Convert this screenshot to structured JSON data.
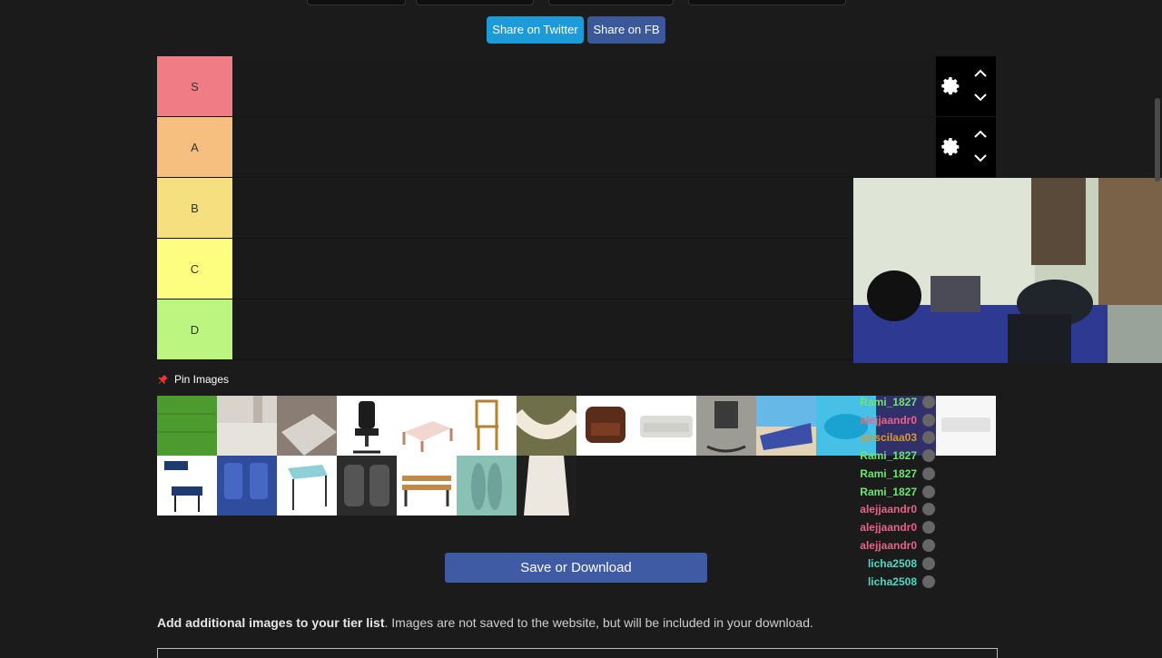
{
  "share": {
    "twitter": "Share on Twitter",
    "fb": "Share on FB"
  },
  "tiers": [
    {
      "label": "S",
      "color": "#f07d85"
    },
    {
      "label": "A",
      "color": "#f6bf7f"
    },
    {
      "label": "B",
      "color": "#f6df7f"
    },
    {
      "label": "C",
      "color": "#fdfd7f"
    },
    {
      "label": "D",
      "color": "#bcf57f"
    }
  ],
  "pin_images": "Pin Images",
  "images": [
    "grass",
    "floor",
    "rug",
    "gaming-chair",
    "bed",
    "wooden-chair",
    "hammock",
    "armchair",
    "sofa",
    "rocking-chair",
    "beach-towel",
    "pool-float",
    "mattress",
    "school-desk-chair",
    "bus-seats",
    "student-desk",
    "car-seats",
    "bench",
    "feet",
    "blouse"
  ],
  "chat": [
    {
      "name": "Rami_1827",
      "color": "#6ee66e"
    },
    {
      "name": "alejjaandr0",
      "color": "#e8638a"
    },
    {
      "name": "priscilaa03",
      "color": "#d89b2b"
    },
    {
      "name": "Rami_1827",
      "color": "#6ee66e"
    },
    {
      "name": "Rami_1827",
      "color": "#6ee66e"
    },
    {
      "name": "Rami_1827",
      "color": "#6ee66e"
    },
    {
      "name": "alejjaandr0",
      "color": "#e8638a"
    },
    {
      "name": "alejjaandr0",
      "color": "#e8638a"
    },
    {
      "name": "alejjaandr0",
      "color": "#e8638a"
    },
    {
      "name": "licha2508",
      "color": "#4fd8c4"
    },
    {
      "name": "licha2508",
      "color": "#4fd8c4"
    }
  ],
  "save_button": "Save or Download",
  "add_images": {
    "bold": "Add additional images to your tier list",
    "rest": ". Images are not saved to the website, but will be included in your download."
  }
}
